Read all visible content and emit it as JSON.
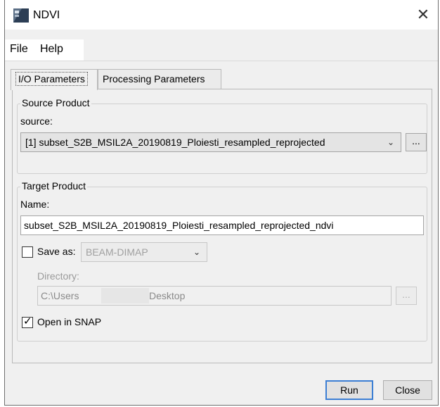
{
  "window": {
    "title": "NDVI",
    "close_symbol": "✕"
  },
  "menu": {
    "items": [
      "File",
      "Help"
    ]
  },
  "tabs": [
    {
      "label": "I/O Parameters",
      "active": true
    },
    {
      "label": "Processing Parameters",
      "active": false
    }
  ],
  "source_product": {
    "group_label": "Source Product",
    "source_label": "source:",
    "source_value": "[1] subset_S2B_MSIL2A_20190819_Ploiesti_resampled_reprojected",
    "browse_label": "..."
  },
  "target_product": {
    "group_label": "Target Product",
    "name_label": "Name:",
    "name_value": "subset_S2B_MSIL2A_20190819_Ploiesti_resampled_reprojected_ndvi",
    "save_as_label": "Save as:",
    "save_as_checked": false,
    "format_value": "BEAM-DIMAP",
    "directory_label": "Directory:",
    "directory_prefix": "C:\\Users",
    "directory_suffix": "Desktop",
    "browse_label": "...",
    "open_in_snap_label": "Open in SNAP",
    "open_in_snap_checked": true
  },
  "buttons": {
    "run": "Run",
    "close": "Close"
  },
  "icons": {
    "app": "snap-app-icon",
    "dropdown": "chevron-down-icon",
    "check": "checkmark-icon"
  }
}
